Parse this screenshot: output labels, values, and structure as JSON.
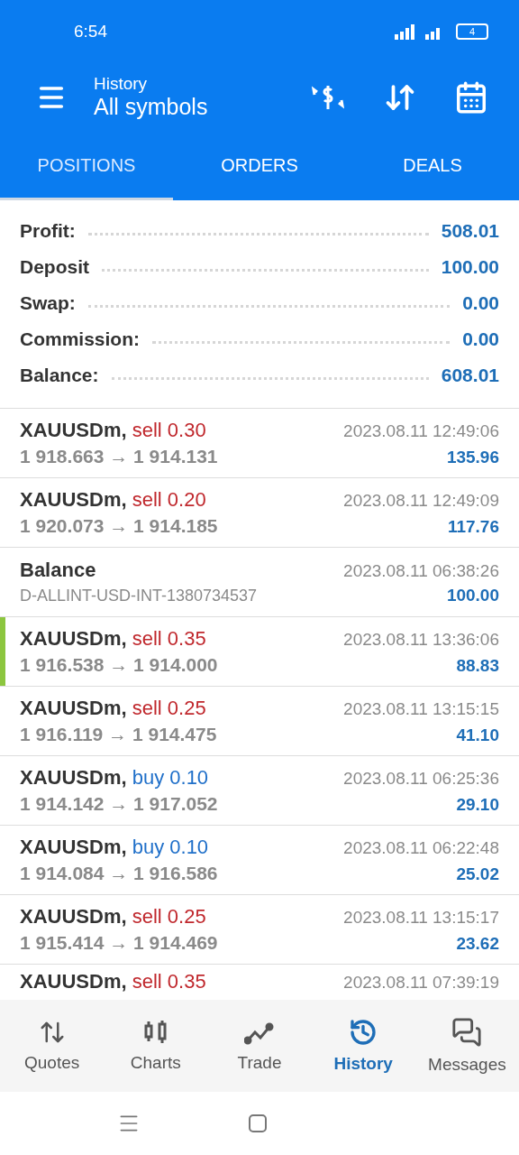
{
  "status_bar": {
    "time": "6:54",
    "battery": "4"
  },
  "app_bar": {
    "subtitle": "History",
    "title": "All symbols"
  },
  "tabs": [
    {
      "label": "POSITIONS",
      "selected": true
    },
    {
      "label": "ORDERS",
      "selected": false
    },
    {
      "label": "DEALS",
      "selected": false
    }
  ],
  "summary": [
    {
      "label": "Profit:",
      "value": "508.01"
    },
    {
      "label": "Deposit",
      "value": "100.00"
    },
    {
      "label": "Swap:",
      "value": "0.00"
    },
    {
      "label": "Commission:",
      "value": "0.00"
    },
    {
      "label": "Balance:",
      "value": "608.01"
    }
  ],
  "deals": [
    {
      "kind": "trade",
      "symbol": "XAUUSDm,",
      "action": "sell 0.30",
      "color": "#c0282d",
      "prices": "1 918.663 → 1 914.131",
      "time": "2023.08.11 12:49:06",
      "profit": "135.96",
      "marked": false
    },
    {
      "kind": "trade",
      "symbol": "XAUUSDm,",
      "action": "sell 0.20",
      "color": "#c0282d",
      "prices": "1 920.073 → 1 914.185",
      "time": "2023.08.11 12:49:09",
      "profit": "117.76",
      "marked": false
    },
    {
      "kind": "balance",
      "symbol": "Balance",
      "comment": "D-ALLINT-USD-INT-1380734537",
      "time": "2023.08.11 06:38:26",
      "profit": "100.00",
      "marked": false
    },
    {
      "kind": "trade",
      "symbol": "XAUUSDm,",
      "action": "sell 0.35",
      "color": "#c0282d",
      "prices": "1 916.538 → 1 914.000",
      "time": "2023.08.11 13:36:06",
      "profit": "88.83",
      "marked": true
    },
    {
      "kind": "trade",
      "symbol": "XAUUSDm,",
      "action": "sell 0.25",
      "color": "#c0282d",
      "prices": "1 916.119 → 1 914.475",
      "time": "2023.08.11 13:15:15",
      "profit": "41.10",
      "marked": false
    },
    {
      "kind": "trade",
      "symbol": "XAUUSDm,",
      "action": "buy 0.10",
      "color": "#1f6fc9",
      "prices": "1 914.142 → 1 917.052",
      "time": "2023.08.11 06:25:36",
      "profit": "29.10",
      "marked": false
    },
    {
      "kind": "trade",
      "symbol": "XAUUSDm,",
      "action": "buy 0.10",
      "color": "#1f6fc9",
      "prices": "1 914.084 → 1 916.586",
      "time": "2023.08.11 06:22:48",
      "profit": "25.02",
      "marked": false
    },
    {
      "kind": "trade",
      "symbol": "XAUUSDm,",
      "action": "sell 0.25",
      "color": "#c0282d",
      "prices": "1 915.414 → 1 914.469",
      "time": "2023.08.11 13:15:17",
      "profit": "23.62",
      "marked": false
    },
    {
      "kind": "partial",
      "symbol": "XAUUSDm,",
      "action": "sell 0.35",
      "color": "#c0282d",
      "time": "2023.08.11 07:39:19",
      "marked": false
    }
  ],
  "bottom_nav": [
    {
      "label": "Quotes",
      "selected": false
    },
    {
      "label": "Charts",
      "selected": false
    },
    {
      "label": "Trade",
      "selected": false
    },
    {
      "label": "History",
      "selected": true
    },
    {
      "label": "Messages",
      "selected": false
    }
  ]
}
